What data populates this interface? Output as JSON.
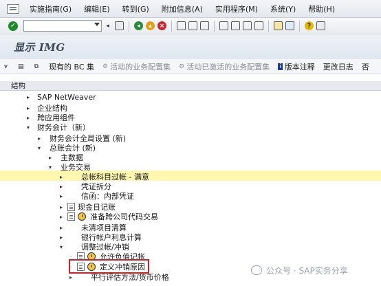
{
  "menu": {
    "items": [
      "实施指南(G)",
      "编辑(E)",
      "转到(G)",
      "附加信息(A)",
      "实用程序(M)",
      "系统(Y)",
      "帮助(H)"
    ]
  },
  "toolbar": {
    "command_value": ""
  },
  "title": "显示 IMG",
  "app_toolbar": {
    "current_bc": "现有的 BC 集",
    "active_config": "活动的业务配置集",
    "active_activated_config": "活动已激活的业务配置集",
    "release_notes": "版本注释",
    "change_log": "更改日志",
    "truncated": "否"
  },
  "section_label": "结构",
  "tree": [
    {
      "label": "SAP NetWeaver",
      "expand": "▸"
    },
    {
      "label": "企业结构",
      "expand": "▸"
    },
    {
      "label": "跨应用组件",
      "expand": "▸"
    },
    {
      "label": "财务会计（新）",
      "expand": "▾"
    },
    {
      "label": "财务会计全局设置 (新)",
      "expand": "▸"
    },
    {
      "label": "总账会计 (新)",
      "expand": "▾"
    },
    {
      "label": "主数据",
      "expand": "▸"
    },
    {
      "label": "业务交易",
      "expand": "▾"
    },
    {
      "label": "总帐科目过帐 - 满意",
      "expand": "▸"
    },
    {
      "label": "凭证拆分",
      "expand": "▸"
    },
    {
      "label": "信函：内部凭证",
      "expand": "▸"
    },
    {
      "label": "现金日记账",
      "expand": "▸"
    },
    {
      "label": "准备跨公司代码交易",
      "expand": "▸"
    },
    {
      "label": "未清项目清算",
      "expand": "▸"
    },
    {
      "label": "银行帐户利息计算",
      "expand": "▸"
    },
    {
      "label": "调整过帐/冲销",
      "expand": "▾"
    },
    {
      "label": "允许负值记帐",
      "expand": "·"
    },
    {
      "label": "定义冲销原因",
      "expand": "·"
    },
    {
      "label": "平行评估方法/货币价格",
      "expand": "▸"
    }
  ],
  "watermark": "公众号 · SAP实务分享",
  "colors": {
    "selection_highlight": "#fff6b0",
    "annotation_box": "#d0202a"
  }
}
